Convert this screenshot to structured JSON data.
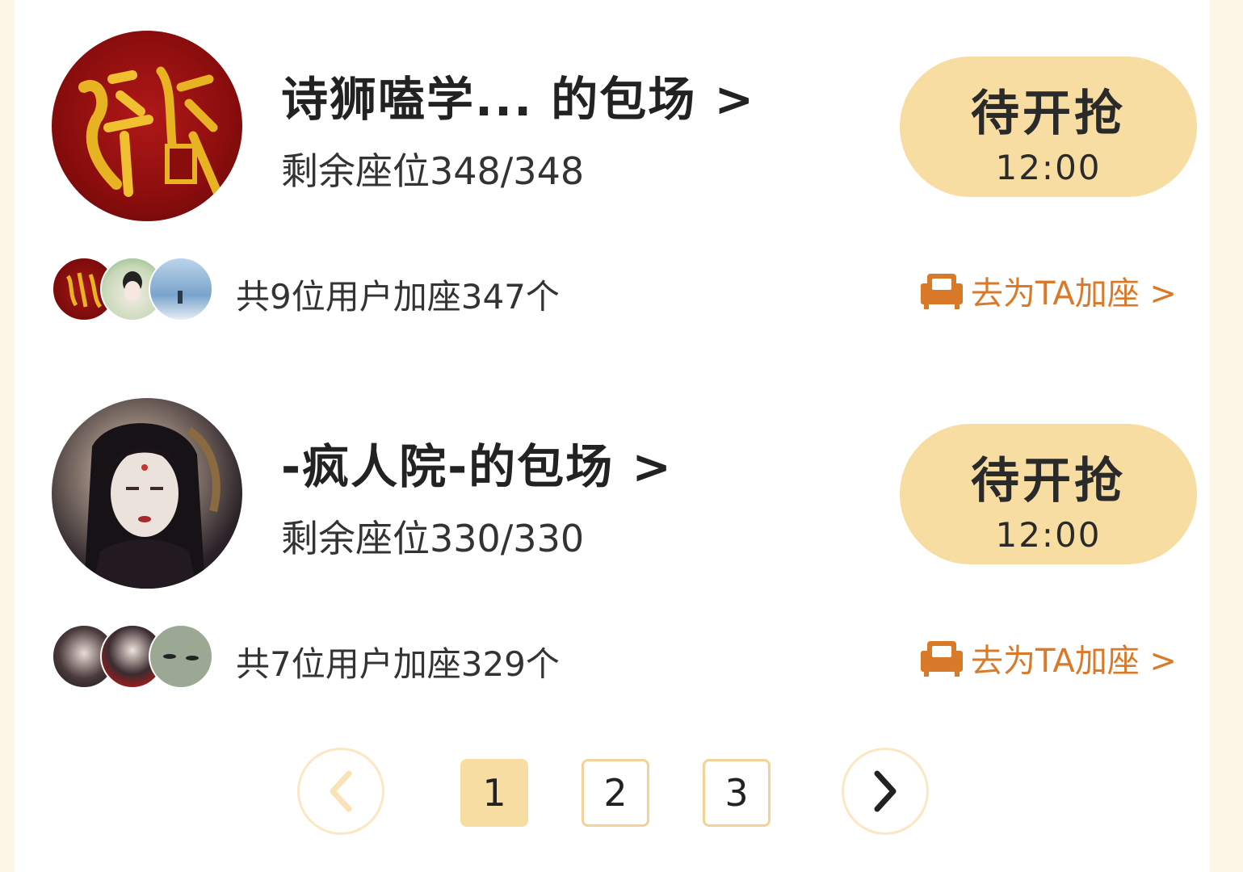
{
  "rooms": [
    {
      "title": "诗狮嗑学...   的包场 >",
      "seats": "剩余座位348/348",
      "grab": {
        "label": "待开抢",
        "time": "12:00"
      },
      "users_text": "共9位用户加座347个",
      "add_seat": "去为TA加座 >",
      "avatar_logo_text": "詩獅"
    },
    {
      "title": "-疯人院-的包场 >",
      "seats": "剩余座位330/330",
      "grab": {
        "label": "待开抢",
        "time": "12:00"
      },
      "users_text": "共7位用户加座329个",
      "add_seat": "去为TA加座 >"
    }
  ],
  "pagination": {
    "pages": [
      "1",
      "2",
      "3"
    ],
    "current": "1",
    "prev_icon": "chevron-left-icon",
    "next_icon": "chevron-right-icon"
  },
  "colors": {
    "accent": "#f8dda2",
    "link": "#d97a2a",
    "background": "#fdf6e6"
  }
}
